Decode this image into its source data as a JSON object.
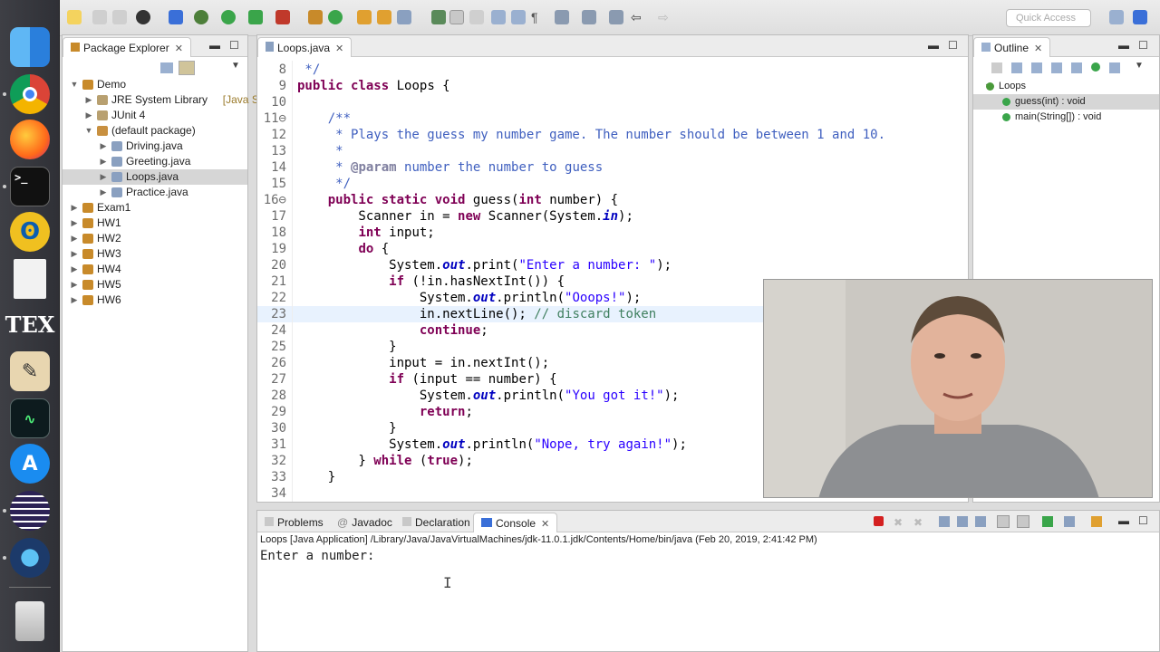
{
  "toolbar": {
    "quick_access_placeholder": "Quick Access"
  },
  "package_explorer": {
    "tab_label": "Package Explorer",
    "tree": [
      {
        "label": "Demo",
        "twisty": "▼"
      },
      {
        "label": "JRE System Library",
        "suffix": "[Java SE",
        "twisty": "▶"
      },
      {
        "label": "JUnit 4",
        "twisty": "▶"
      },
      {
        "label": "(default package)",
        "twisty": "▼"
      },
      {
        "label": "Driving.java",
        "twisty": "▶"
      },
      {
        "label": "Greeting.java",
        "twisty": "▶"
      },
      {
        "label": "Loops.java",
        "twisty": "▶"
      },
      {
        "label": "Practice.java",
        "twisty": "▶"
      },
      {
        "label": "Exam1",
        "twisty": "▶"
      },
      {
        "label": "HW1",
        "twisty": "▶"
      },
      {
        "label": "HW2",
        "twisty": "▶"
      },
      {
        "label": "HW3",
        "twisty": "▶"
      },
      {
        "label": "HW4",
        "twisty": "▶"
      },
      {
        "label": "HW5",
        "twisty": "▶"
      },
      {
        "label": "HW6",
        "twisty": "▶"
      }
    ]
  },
  "editor": {
    "tab_label": "Loops.java",
    "lines": [
      {
        "n": "8",
        "text": " */"
      },
      {
        "n": "9",
        "text": "public class Loops {"
      },
      {
        "n": "10",
        "text": ""
      },
      {
        "n": "11⊖",
        "text": "    /**"
      },
      {
        "n": "12",
        "text": "     * Plays the guess my number game. The number should be between 1 and 10."
      },
      {
        "n": "13",
        "text": "     *"
      },
      {
        "n": "14",
        "text": "     * @param number the number to guess"
      },
      {
        "n": "15",
        "text": "     */"
      },
      {
        "n": "16⊖",
        "text": "    public static void guess(int number) {"
      },
      {
        "n": "17",
        "text": "        Scanner in = new Scanner(System.in);"
      },
      {
        "n": "18",
        "text": "        int input;"
      },
      {
        "n": "19",
        "text": "        do {"
      },
      {
        "n": "20",
        "text": "            System.out.print(\"Enter a number: \");"
      },
      {
        "n": "21",
        "text": "            if (!in.hasNextInt()) {"
      },
      {
        "n": "22",
        "text": "                System.out.println(\"Ooops!\");"
      },
      {
        "n": "23",
        "text": "                in.nextLine(); // discard token"
      },
      {
        "n": "24",
        "text": "                continue;"
      },
      {
        "n": "25",
        "text": "            }"
      },
      {
        "n": "26",
        "text": "            input = in.nextInt();"
      },
      {
        "n": "27",
        "text": "            if (input == number) {"
      },
      {
        "n": "28",
        "text": "                System.out.println(\"You got it!\");"
      },
      {
        "n": "29",
        "text": "                return;"
      },
      {
        "n": "30",
        "text": "            }"
      },
      {
        "n": "31",
        "text": "            System.out.println(\"Nope, try again!\");"
      },
      {
        "n": "32",
        "text": "        } while (true);"
      },
      {
        "n": "33",
        "text": "    }"
      },
      {
        "n": "34",
        "text": ""
      }
    ]
  },
  "outline": {
    "tab_label": "Outline",
    "items": [
      {
        "label": "Loops"
      },
      {
        "label": "guess(int) : void"
      },
      {
        "label": "main(String[]) : void"
      }
    ]
  },
  "console": {
    "tabs": [
      "Problems",
      "Javadoc",
      "Declaration",
      "Console"
    ],
    "status": "Loops [Java Application] /Library/Java/JavaVirtualMachines/jdk-11.0.1.jdk/Contents/Home/bin/java (Feb 20, 2019, 2:41:42 PM)",
    "output": "Enter a number:"
  },
  "dock": {
    "tex_label": "TEX"
  },
  "colors": {
    "keyword": "#7f0055",
    "comment": "#3f7f5f",
    "javadoc": "#3f5fbf",
    "string": "#2a00ff",
    "field": "#0000c0"
  }
}
